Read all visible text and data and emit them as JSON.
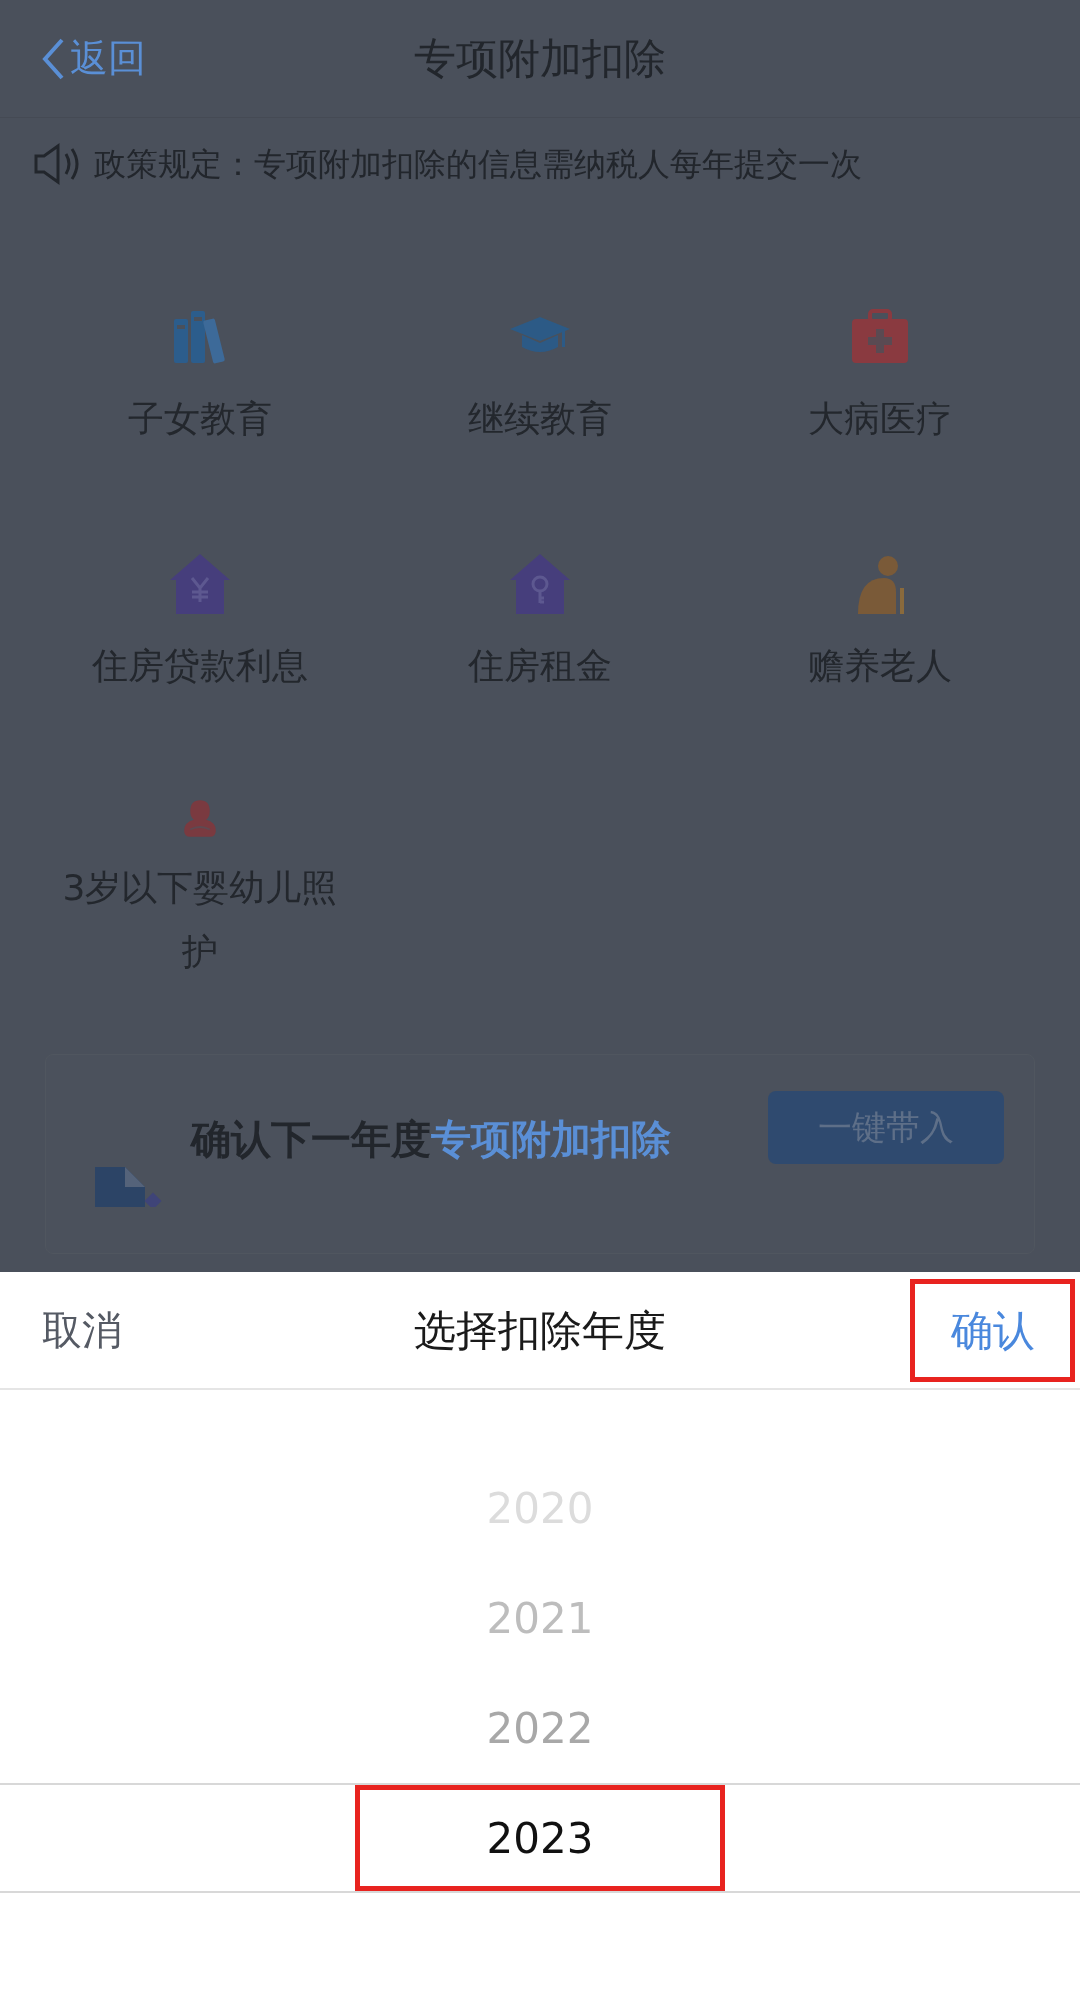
{
  "header": {
    "back_label": "返回",
    "title": "专项附加扣除"
  },
  "notice": {
    "text": "政策规定：专项附加扣除的信息需纳税人每年提交一次"
  },
  "categories": [
    {
      "label": "子女教育"
    },
    {
      "label": "继续教育"
    },
    {
      "label": "大病医疗"
    },
    {
      "label": "住房贷款利息"
    },
    {
      "label": "住房租金"
    },
    {
      "label": "赡养老人"
    },
    {
      "label": "3岁以下婴幼儿照护"
    }
  ],
  "banner": {
    "title": "确认下一年度",
    "title_highlight": "专项附加扣除",
    "button": "一键带入"
  },
  "picker": {
    "cancel": "取消",
    "title": "选择扣除年度",
    "confirm": {
      "label": "确认",
      "highlighted": true
    },
    "years": [
      {
        "label": "2020",
        "selected": false
      },
      {
        "label": "2021",
        "selected": false
      },
      {
        "label": "2022",
        "selected": false
      },
      {
        "label": "2023",
        "selected": true
      }
    ]
  }
}
